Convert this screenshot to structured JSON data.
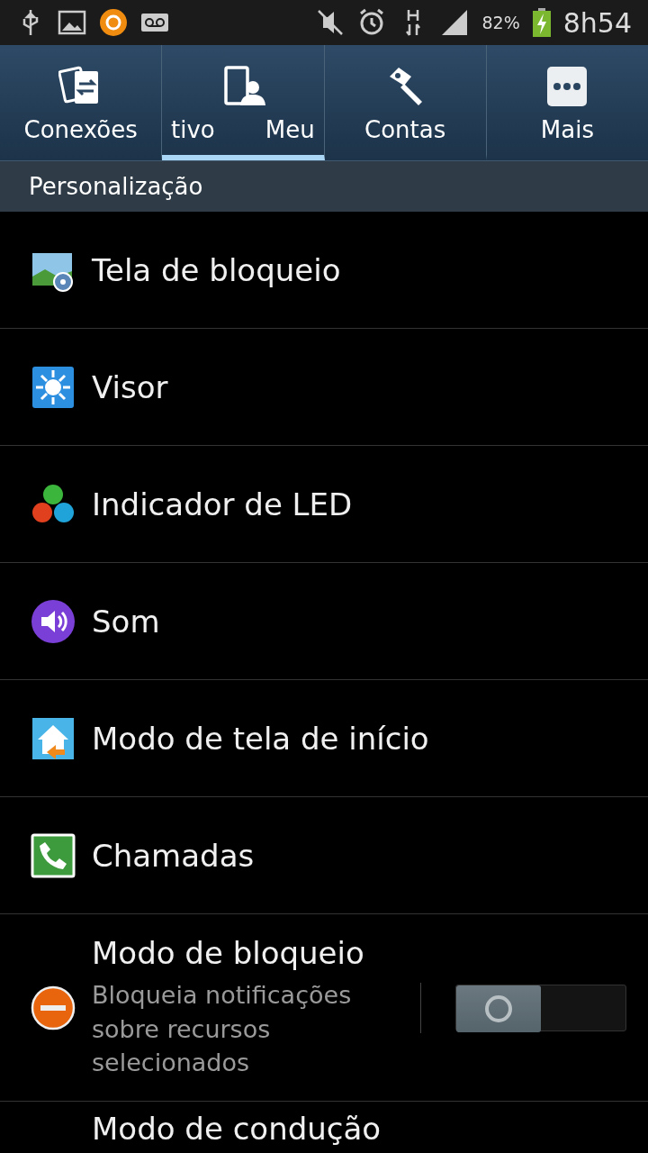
{
  "status_bar": {
    "battery_text": "82%",
    "time": "8h54"
  },
  "tabs": [
    {
      "label_parts": [
        "Conexões"
      ],
      "kind": "connections",
      "selected": false
    },
    {
      "label_parts": [
        "tivo",
        "Meu"
      ],
      "kind": "device",
      "selected": true
    },
    {
      "label_parts": [
        "Contas"
      ],
      "kind": "key",
      "selected": false
    },
    {
      "label_parts": [
        "Mais"
      ],
      "kind": "more",
      "selected": false
    }
  ],
  "section": {
    "title": "Personalização"
  },
  "items": [
    {
      "kind": "lockscreen",
      "title": "Tela de bloqueio"
    },
    {
      "kind": "display",
      "title": "Visor"
    },
    {
      "kind": "led",
      "title": "Indicador de LED"
    },
    {
      "kind": "sound",
      "title": "Som"
    },
    {
      "kind": "home",
      "title": "Modo de tela de início"
    },
    {
      "kind": "phone",
      "title": "Chamadas"
    },
    {
      "kind": "blocking",
      "title": "Modo de bloqueio",
      "subtitle": "Bloqueia notificações sobre recursos selecionados",
      "on": false
    },
    {
      "kind": "none",
      "title": "Modo de condução"
    }
  ]
}
